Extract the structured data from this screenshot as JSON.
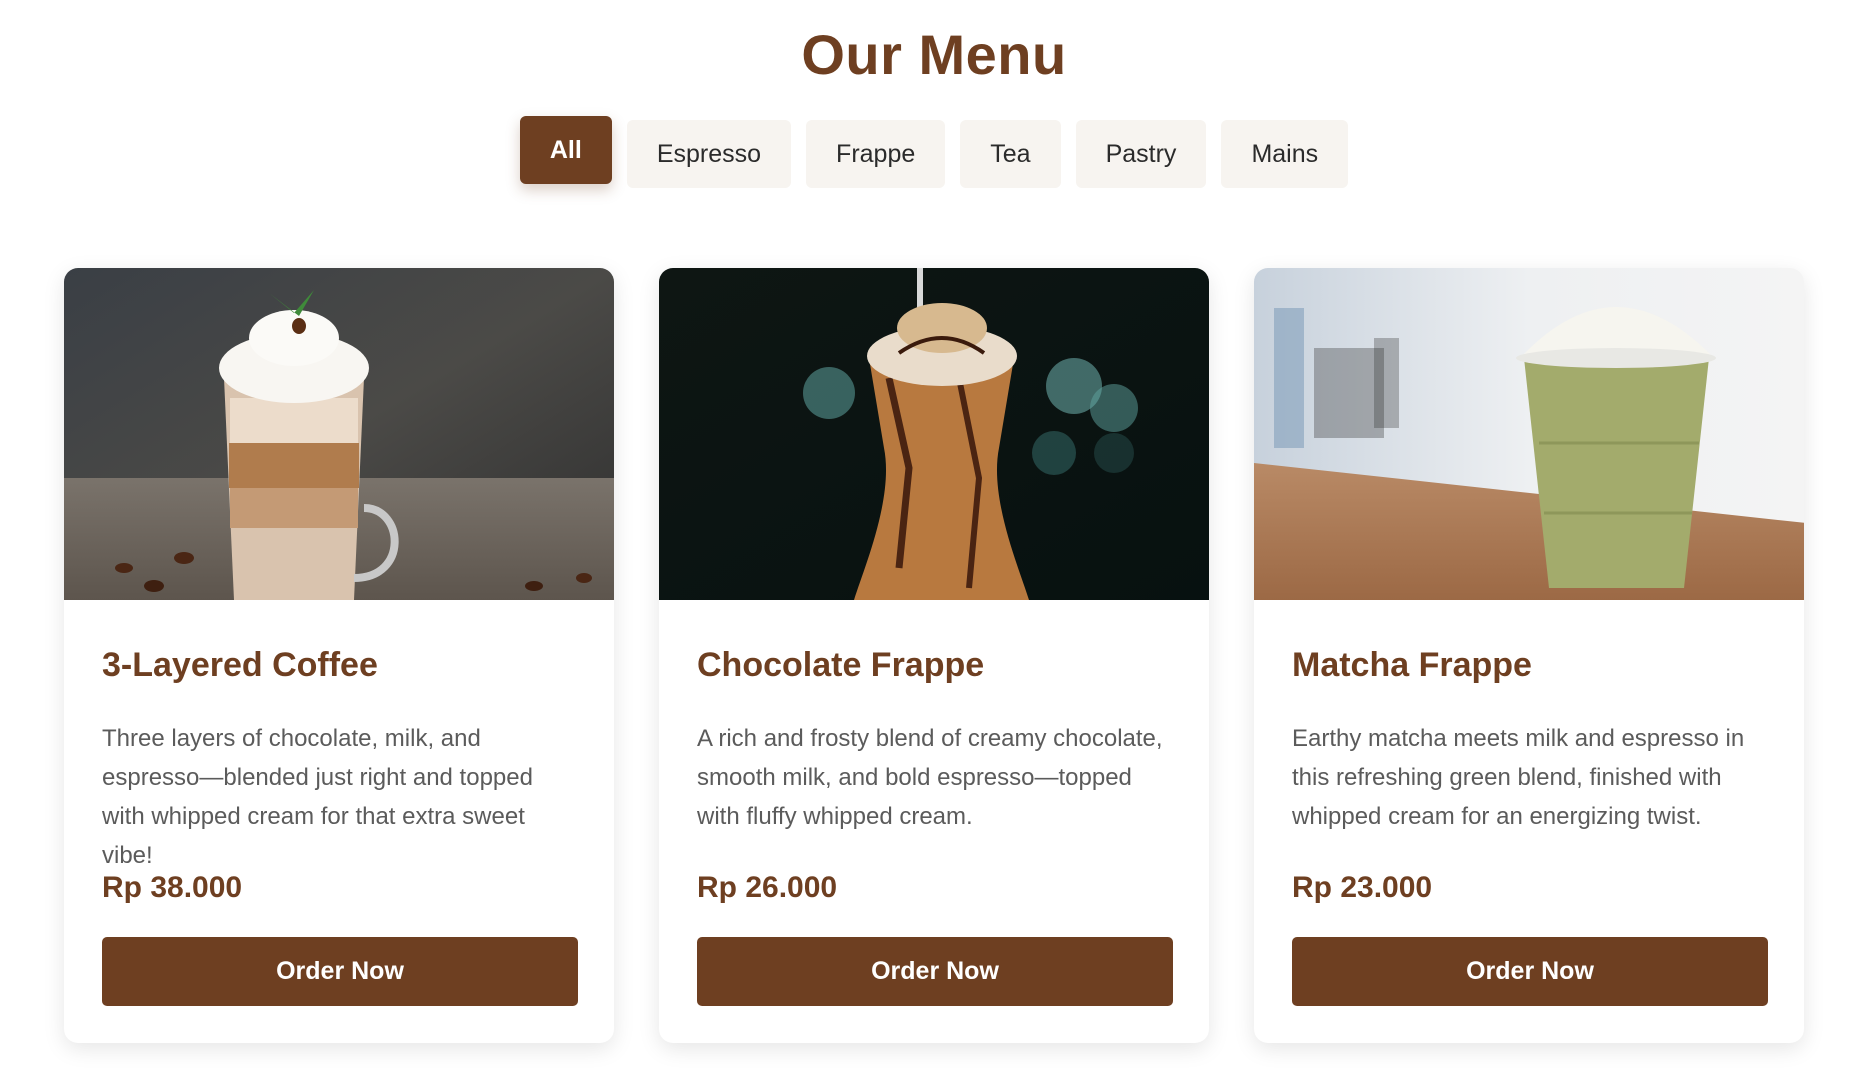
{
  "page": {
    "title": "Our Menu"
  },
  "filters": [
    {
      "label": "All",
      "active": true
    },
    {
      "label": "Espresso"
    },
    {
      "label": "Frappe"
    },
    {
      "label": "Tea"
    },
    {
      "label": "Pastry"
    },
    {
      "label": "Mains"
    }
  ],
  "menu_items": [
    {
      "name": "3-Layered Coffee",
      "description": "Three layers of chocolate, milk, and espresso—blended just right and topped with whipped cream for that extra sweet vibe!",
      "price": "Rp 38.000",
      "button": "Order Now",
      "image": "layered-coffee-photo"
    },
    {
      "name": "Chocolate Frappe",
      "description": "A rich and frosty blend of creamy chocolate, smooth milk, and bold espresso—topped with fluffy whipped cream.",
      "price": "Rp 26.000",
      "button": "Order Now",
      "image": "chocolate-frappe-photo"
    },
    {
      "name": "Matcha Frappe",
      "description": "Earthy matcha meets milk and espresso in this refreshing green blend, finished with whipped cream for an energizing twist.",
      "price": "Rp 23.000",
      "button": "Order Now",
      "image": "matcha-frappe-photo"
    }
  ],
  "colors": {
    "brand": "#6e3f21",
    "filter_bg": "#f7f4f0",
    "text_muted": "#5b5b5b"
  }
}
